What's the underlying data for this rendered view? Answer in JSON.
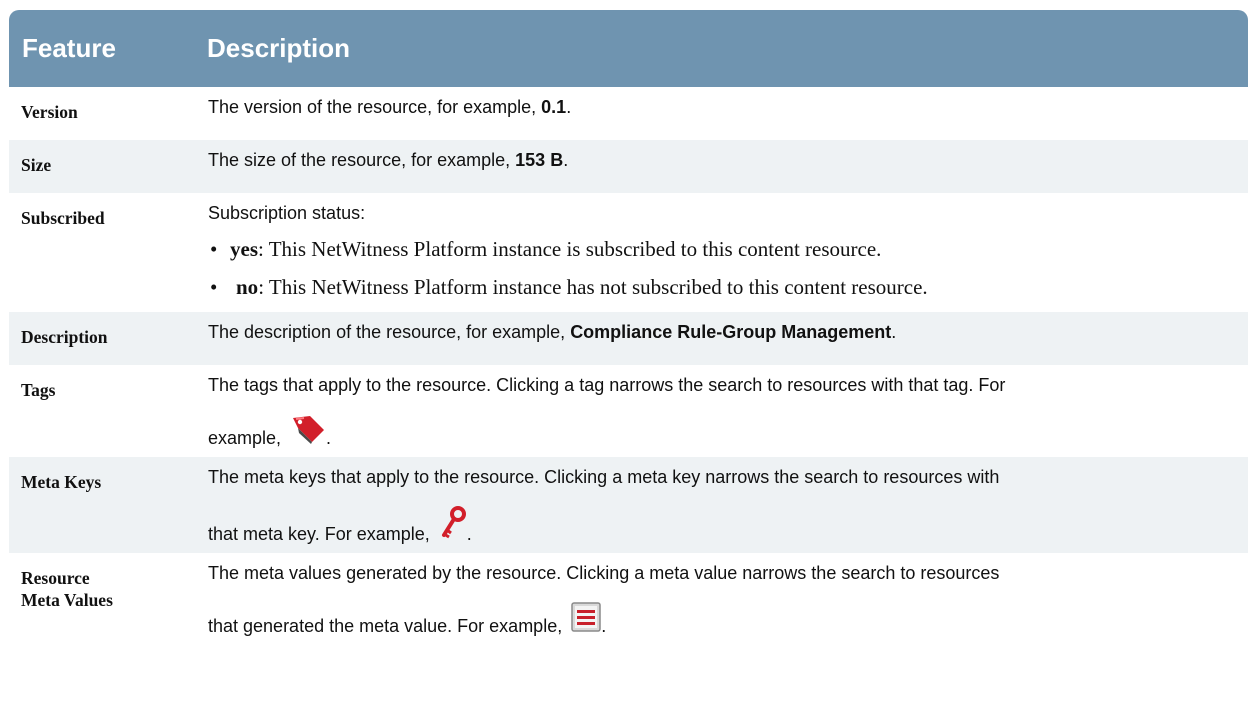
{
  "table": {
    "headers": {
      "feature": "Feature",
      "description": "Description"
    },
    "rows": {
      "version": {
        "feature": "Version",
        "text": "The version of the resource, for example, ",
        "bold": "0.1",
        "tail": "."
      },
      "size": {
        "feature": "Size",
        "text": "The size of the resource, for example, ",
        "bold": "153 B",
        "tail": "."
      },
      "subscribed": {
        "feature": "Subscribed",
        "intro": "Subscription status:",
        "items": [
          {
            "bullet": "•",
            "term": "yes",
            "text": ": This NetWitness Platform instance is subscribed to this content resource."
          },
          {
            "bullet": "•",
            "term": "no",
            "text": ": This NetWitness Platform instance has not subscribed to this content resource."
          }
        ]
      },
      "description": {
        "feature": "Description",
        "text": "The description of the resource, for example, ",
        "bold": "Compliance Rule-Group Management",
        "tail": "."
      },
      "tags": {
        "feature": "Tags",
        "line1": "The tags that apply to the resource. Clicking a tag narrows the search to resources with that tag. For",
        "line2": "example, ",
        "tail": ".",
        "icon": "tag-icon",
        "icon_color": "#d21f2a"
      },
      "meta_keys": {
        "feature": "Meta Keys",
        "line1": "The meta keys that apply to the resource. Clicking a meta key narrows the search to resources with",
        "line2": "that meta key. For example, ",
        "tail": ".",
        "icon": "key-icon",
        "icon_color": "#d21f2a"
      },
      "meta_values": {
        "feature_line1": "Resource",
        "feature_line2": "Meta Values",
        "line1": "The meta values generated by the resource. Clicking a meta value narrows the search to resources",
        "line2": "that generated the meta value. For example, ",
        "tail": ".",
        "icon": "meta-value-icon",
        "icon_color": "#c8202b"
      }
    }
  }
}
